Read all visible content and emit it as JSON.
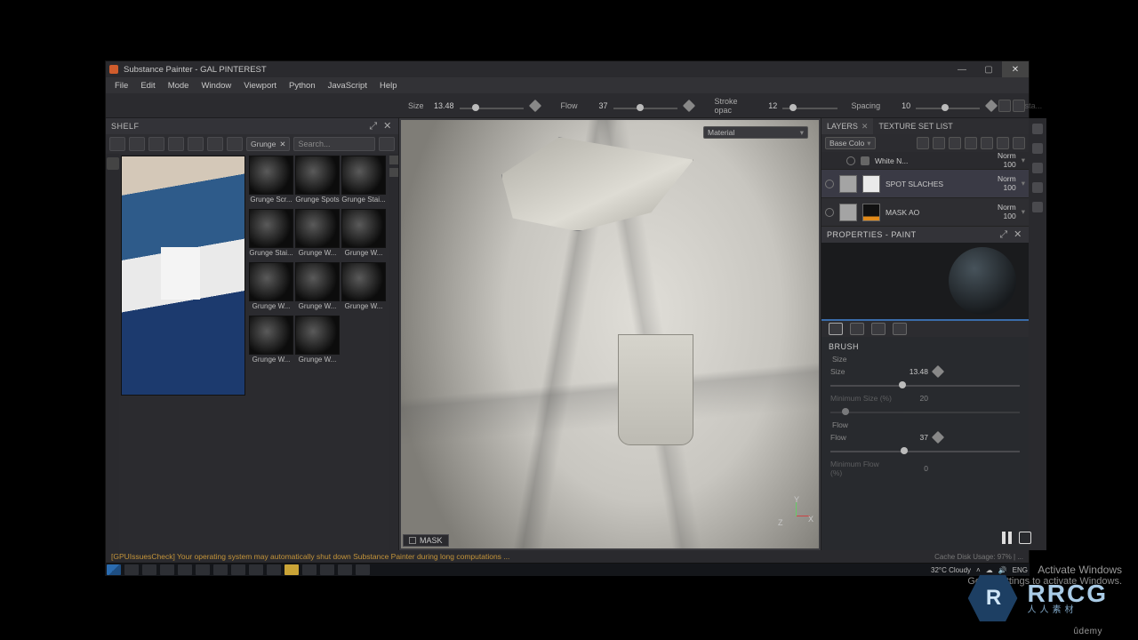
{
  "window": {
    "title": "Substance Painter - GAL PINTEREST"
  },
  "menu": {
    "file": "File",
    "edit": "Edit",
    "mode": "Mode",
    "window": "Window",
    "viewport": "Viewport",
    "python": "Python",
    "javascript": "JavaScript",
    "help": "Help"
  },
  "brushbar": {
    "size_label": "Size",
    "size_value": "13.48",
    "flow_label": "Flow",
    "flow_value": "37",
    "opacity_label": "Stroke opac",
    "opacity_value": "12",
    "spacing_label": "Spacing",
    "spacing_value": "10",
    "distance_label": "Dista..."
  },
  "material_dropdown": {
    "label": "Material"
  },
  "shelf": {
    "title": "SHELF",
    "filter_chip": "Grunge",
    "search_placeholder": "Search...",
    "thumbs": [
      "Grunge Scr...",
      "Grunge Spots",
      "Grunge Stai...",
      "Grunge Stai...",
      "Grunge W...",
      "Grunge W...",
      "Grunge W...",
      "Grunge W...",
      "Grunge W...",
      "Grunge W...",
      "Grunge W..."
    ]
  },
  "viewport": {
    "mask_tag": "MASK",
    "axis_x": "X",
    "axis_y": "Y",
    "axis_z": "Z"
  },
  "right": {
    "tab_layers": "LAYERS",
    "tab_texset": "TEXTURE SET LIST",
    "channel": "Base Colo",
    "sublayer": {
      "name": "White N...",
      "mode": "Norm",
      "opacity": "100"
    },
    "layers": [
      {
        "name": "SPOT SLACHES",
        "mode": "Norm",
        "opacity": "100"
      },
      {
        "name": "MASK AO",
        "mode": "Norm",
        "opacity": "100"
      }
    ],
    "properties_title": "PROPERTIES - PAINT",
    "brush_section": "BRUSH",
    "size_sub": "Size",
    "size_label": "Size",
    "size_value": "13.48",
    "minsize_label": "Minimum Size (%)",
    "minsize_value": "20",
    "flow_sub": "Flow",
    "flow_label": "Flow",
    "flow_value": "37",
    "minflow_label": "Minimum Flow (%)",
    "minflow_value": "0"
  },
  "status": {
    "warning": "[GPUIssuesCheck] Your operating system may automatically shut down Substance Painter during long computations ...",
    "cache": "Cache Disk Usage:  97% | ..."
  },
  "watermark": {
    "title": "Activate Windows",
    "sub": "Go to Settings to activate Windows."
  },
  "taskbar": {
    "weather": "32°C  Cloudy",
    "lang": "ENG"
  },
  "logo": {
    "r": "R",
    "big": "RRCG",
    "small": "人人素材"
  },
  "udemy": "ûdemy"
}
